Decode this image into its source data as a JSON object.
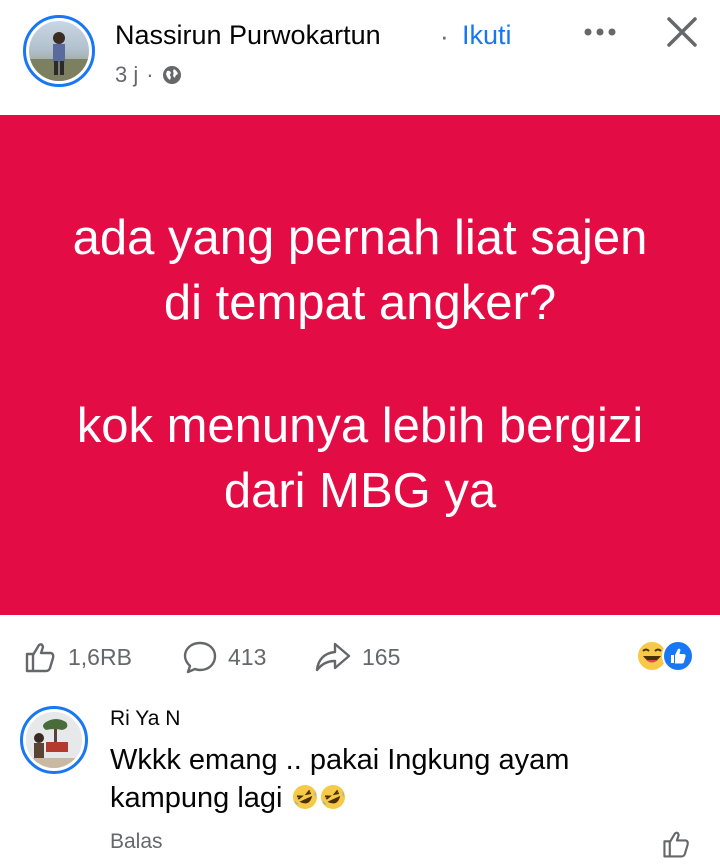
{
  "post": {
    "author": "Nassirun Purwokartun",
    "separator": "·",
    "follow_label": "Ikuti",
    "time": "3 j",
    "meta_dot": "·"
  },
  "banner": {
    "background": "#e30c45",
    "line_group_1": "ada yang pernah liat sajen di tempat angker?",
    "line_group_2": "kok menunya lebih bergizi dari MBG ya"
  },
  "stats": {
    "likes": "1,6RB",
    "comments": "413",
    "shares": "165"
  },
  "reactions": [
    "laughing-emoji",
    "like-badge"
  ],
  "comment": {
    "name": "Ri Ya N",
    "text": "Wkkk emang .. pakai Ingkung ayam kampung lagi",
    "emojis": [
      "rolling-laughing-emoji",
      "rolling-laughing-emoji"
    ],
    "reply_label": "Balas"
  },
  "colors": {
    "accent": "#1877f2",
    "secondary_text": "#65676b"
  }
}
